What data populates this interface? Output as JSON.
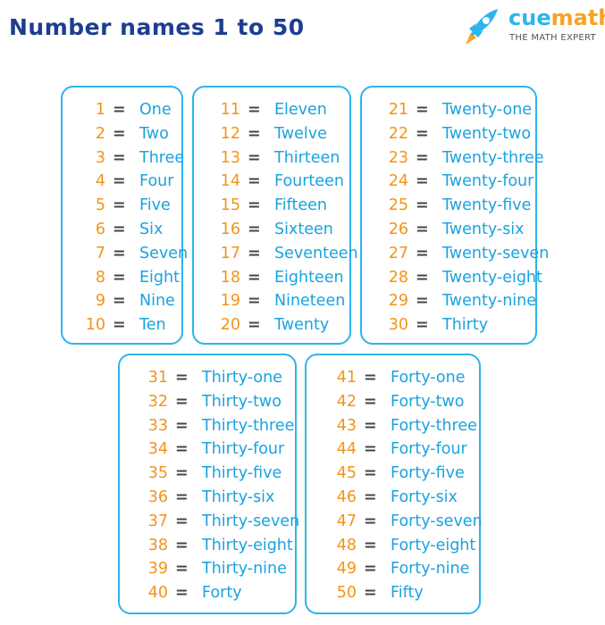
{
  "title": "Number names 1 to 50",
  "logo": {
    "name_part1": "cue",
    "name_part2": "math",
    "tagline": "THE MATH EXPERT",
    "icon": "rocket-icon"
  },
  "colors": {
    "title": "#1d3e8f",
    "number": "#f39419",
    "word": "#19a3e0",
    "border": "#2db4ec"
  },
  "equals": "=",
  "boxes": [
    {
      "items": [
        {
          "n": "1",
          "w": "One"
        },
        {
          "n": "2",
          "w": "Two"
        },
        {
          "n": "3",
          "w": "Three"
        },
        {
          "n": "4",
          "w": "Four"
        },
        {
          "n": "5",
          "w": "Five"
        },
        {
          "n": "6",
          "w": "Six"
        },
        {
          "n": "7",
          "w": "Seven"
        },
        {
          "n": "8",
          "w": "Eight"
        },
        {
          "n": "9",
          "w": "Nine"
        },
        {
          "n": "10",
          "w": "Ten"
        }
      ]
    },
    {
      "items": [
        {
          "n": "11",
          "w": "Eleven"
        },
        {
          "n": "12",
          "w": "Twelve"
        },
        {
          "n": "13",
          "w": "Thirteen"
        },
        {
          "n": "14",
          "w": "Fourteen"
        },
        {
          "n": "15",
          "w": "Fifteen"
        },
        {
          "n": "16",
          "w": "Sixteen"
        },
        {
          "n": "17",
          "w": "Seventeen"
        },
        {
          "n": "18",
          "w": "Eighteen"
        },
        {
          "n": "19",
          "w": "Nineteen"
        },
        {
          "n": "20",
          "w": "Twenty"
        }
      ]
    },
    {
      "items": [
        {
          "n": "21",
          "w": "Twenty-one"
        },
        {
          "n": "22",
          "w": "Twenty-two"
        },
        {
          "n": "23",
          "w": "Twenty-three"
        },
        {
          "n": "24",
          "w": "Twenty-four"
        },
        {
          "n": "25",
          "w": "Twenty-five"
        },
        {
          "n": "26",
          "w": "Twenty-six"
        },
        {
          "n": "27",
          "w": "Twenty-seven"
        },
        {
          "n": "28",
          "w": "Twenty-eight"
        },
        {
          "n": "29",
          "w": "Twenty-nine"
        },
        {
          "n": "30",
          "w": "Thirty"
        }
      ]
    },
    {
      "items": [
        {
          "n": "31",
          "w": "Thirty-one"
        },
        {
          "n": "32",
          "w": "Thirty-two"
        },
        {
          "n": "33",
          "w": "Thirty-three"
        },
        {
          "n": "34",
          "w": "Thirty-four"
        },
        {
          "n": "35",
          "w": "Thirty-five"
        },
        {
          "n": "36",
          "w": "Thirty-six"
        },
        {
          "n": "37",
          "w": "Thirty-seven"
        },
        {
          "n": "38",
          "w": "Thirty-eight"
        },
        {
          "n": "39",
          "w": "Thirty-nine"
        },
        {
          "n": "40",
          "w": "Forty"
        }
      ]
    },
    {
      "items": [
        {
          "n": "41",
          "w": "Forty-one"
        },
        {
          "n": "42",
          "w": "Forty-two"
        },
        {
          "n": "43",
          "w": "Forty-three"
        },
        {
          "n": "44",
          "w": "Forty-four"
        },
        {
          "n": "45",
          "w": "Forty-five"
        },
        {
          "n": "46",
          "w": "Forty-six"
        },
        {
          "n": "47",
          "w": "Forty-seven"
        },
        {
          "n": "48",
          "w": "Forty-eight"
        },
        {
          "n": "49",
          "w": "Forty-nine"
        },
        {
          "n": "50",
          "w": "Fifty"
        }
      ]
    }
  ]
}
